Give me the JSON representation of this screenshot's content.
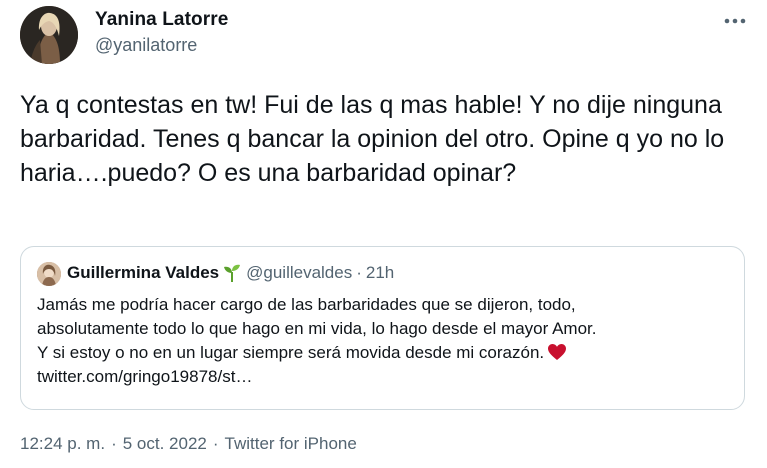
{
  "author": {
    "name": "Yanina Latorre",
    "handle": "@yanilatorre"
  },
  "tweet": {
    "text": "Ya q contestas en tw! Fui de las q mas hable! Y no dije ninguna barbaridad. Tenes q bancar la opinion del otro. Opine q yo no lo haria….puedo? O es una barbaridad opinar?"
  },
  "quoted": {
    "name": "Guillermina Valdes",
    "handle": "@guillevaldes",
    "separator": "·",
    "time": "21h",
    "lines": [
      "Jamás me podría hacer cargo de las barbaridades que se dijeron, todo,",
      "absolutamente todo lo que hago en mi vida, lo hago desde el mayor Amor.",
      "Y si estoy o no en un lugar siempre será movida desde mi corazón.",
      "twitter.com/gringo19878/st…"
    ]
  },
  "meta": {
    "time": "12:24 p. m.",
    "separator": "·",
    "date": "5 oct. 2022",
    "source": "Twitter for iPhone"
  },
  "icons": {
    "more": "more-horizontal-icon",
    "sprout": "seedling-icon",
    "heart": "red-heart-icon"
  },
  "colors": {
    "text_primary": "#0f1419",
    "text_secondary": "#536471",
    "border": "#cfd9de",
    "sprout": "#5aa02c",
    "heart": "#c8102e"
  }
}
